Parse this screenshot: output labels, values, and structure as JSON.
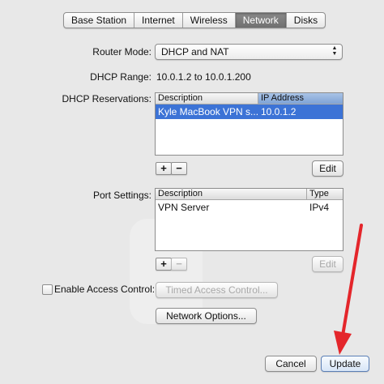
{
  "tabs": [
    "Base Station",
    "Internet",
    "Wireless",
    "Network",
    "Disks"
  ],
  "router_mode": {
    "label": "Router Mode:",
    "value": "DHCP and NAT"
  },
  "dhcp_range": {
    "label": "DHCP Range:",
    "value": "10.0.1.2 to 10.0.1.200"
  },
  "dhcp_reservations": {
    "label": "DHCP Reservations:",
    "columns": [
      "Description",
      "IP Address"
    ],
    "rows": [
      {
        "description": "Kyle MacBook VPN s...",
        "ip": "10.0.1.2"
      }
    ],
    "add_label": "+",
    "remove_label": "−",
    "edit_label": "Edit"
  },
  "port_settings": {
    "label": "Port Settings:",
    "columns": [
      "Description",
      "Type"
    ],
    "rows": [
      {
        "description": "VPN Server",
        "type": "IPv4"
      }
    ],
    "add_label": "+",
    "remove_label": "−",
    "edit_label": "Edit"
  },
  "access_control": {
    "checkbox_label": "Enable Access Control:",
    "timed_button": "Timed Access Control..."
  },
  "network_options_button": "Network Options...",
  "cancel_button": "Cancel",
  "update_button": "Update",
  "colors": {
    "selection": "#3c73d6",
    "arrow": "#e4262b",
    "active_tab": "#7a7a7a"
  }
}
